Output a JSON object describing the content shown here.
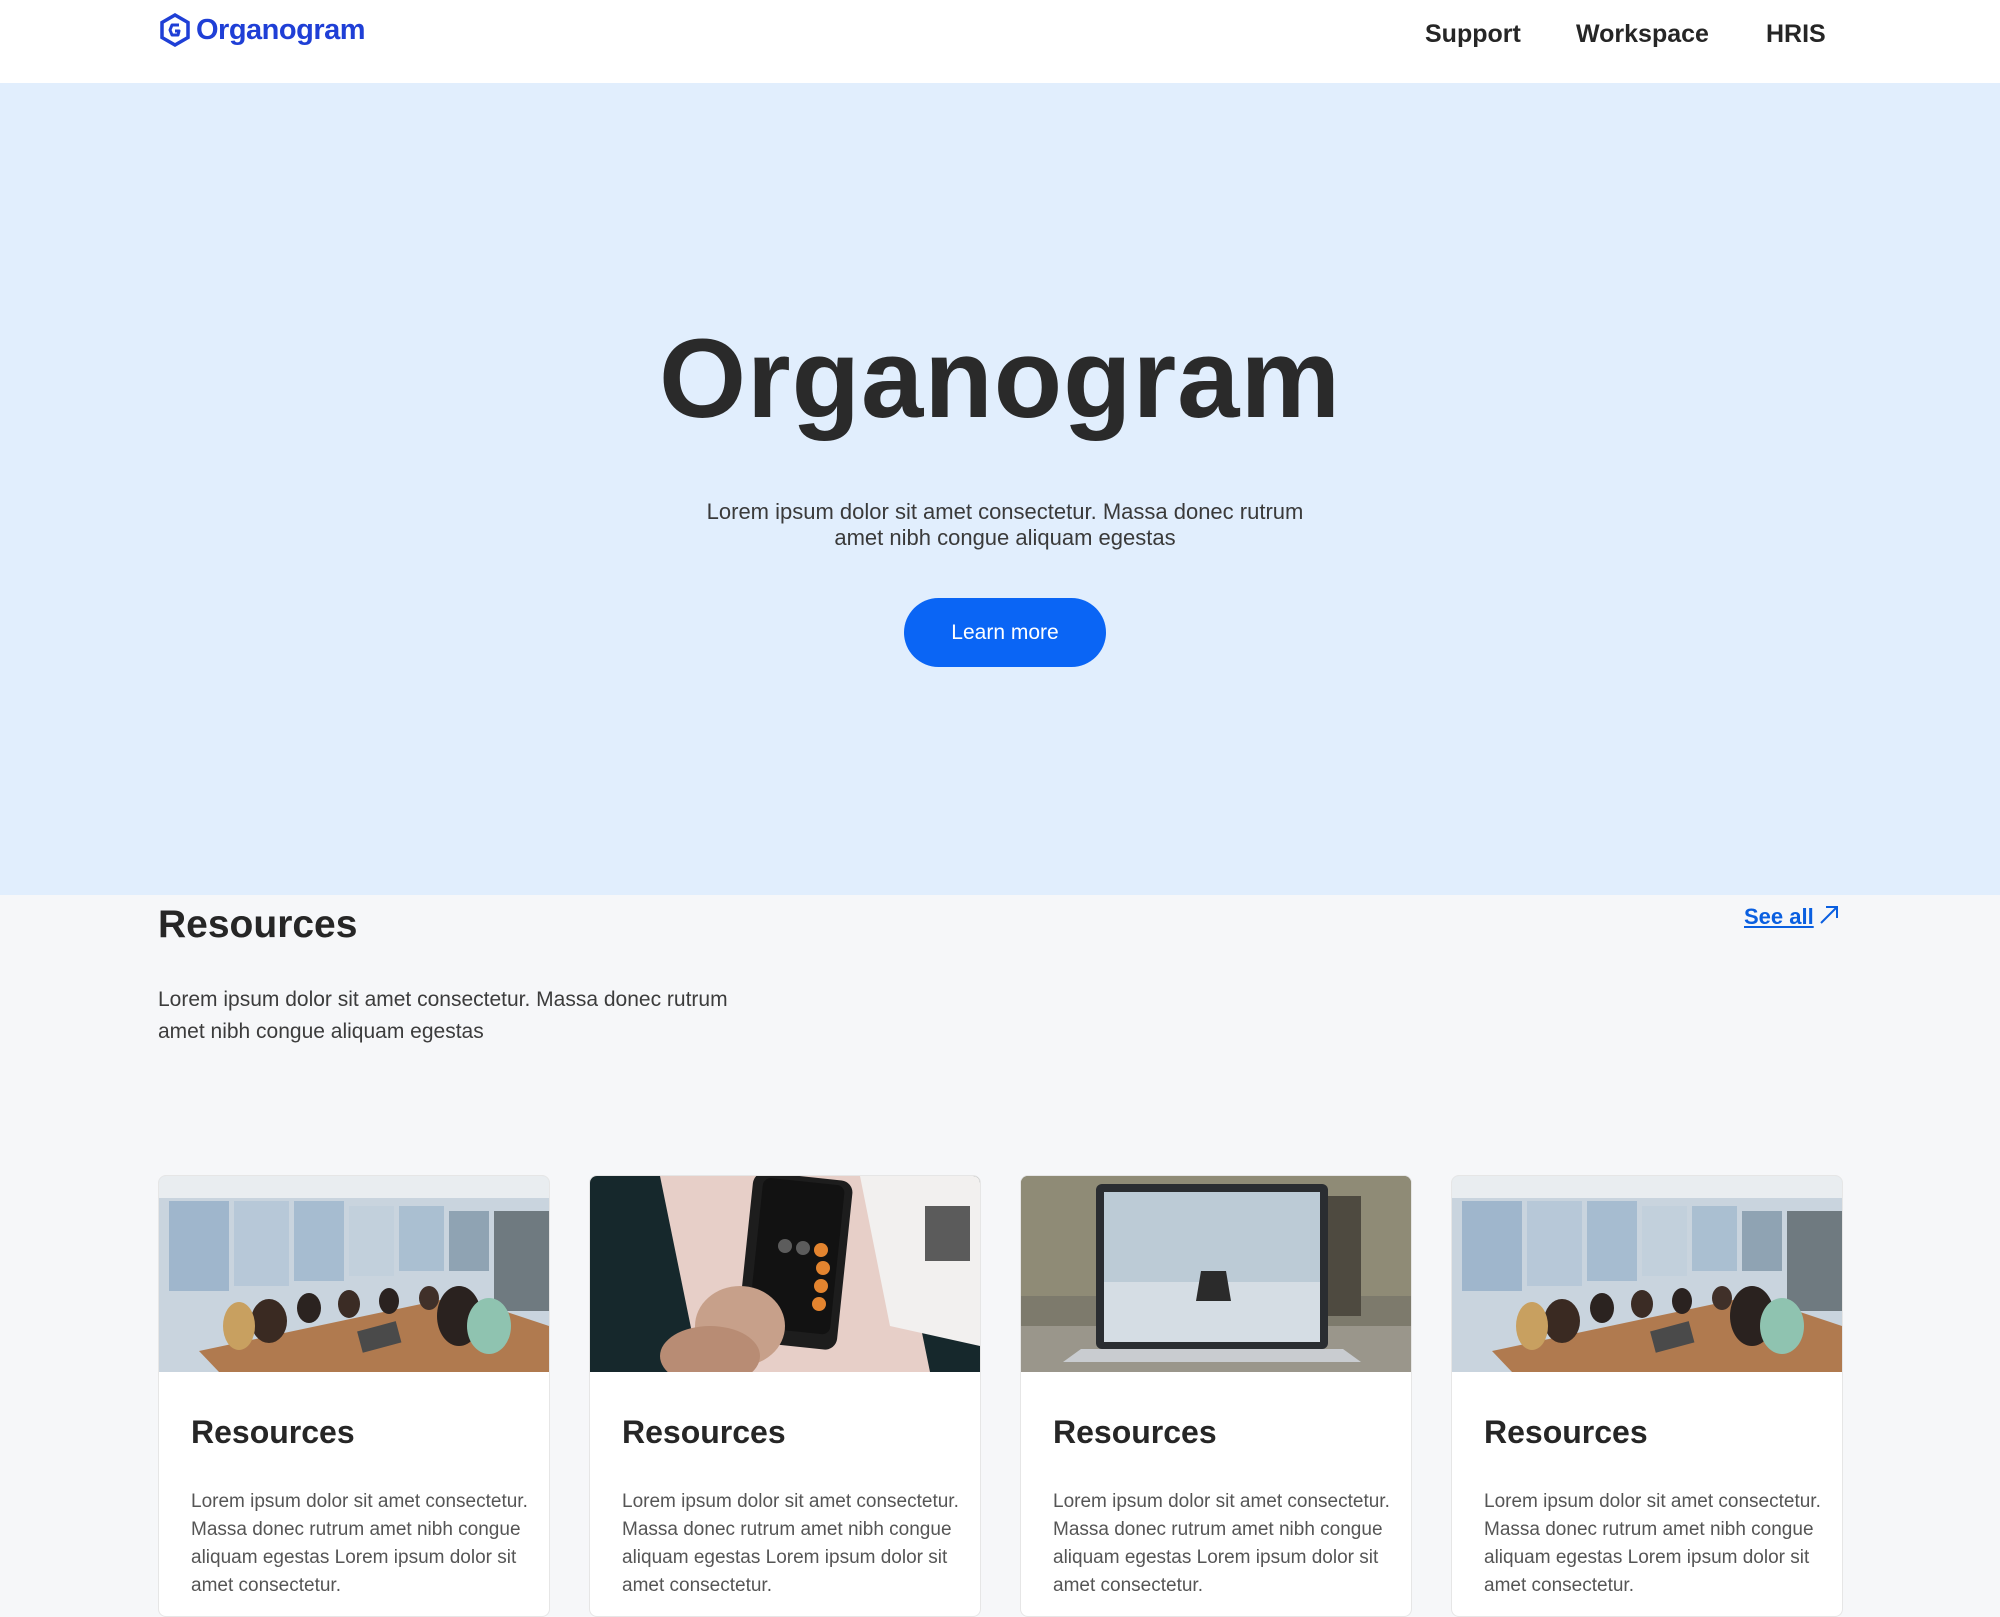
{
  "header": {
    "logo_text": "Organogram",
    "nav": [
      "Support",
      "Workspace",
      "HRIS"
    ]
  },
  "hero": {
    "title": "Organogram",
    "subtitle": "Lorem ipsum dolor sit amet consectetur. Massa donec rutrum amet nibh congue aliquam egestas",
    "cta_label": "Learn more"
  },
  "resources": {
    "heading": "Resources",
    "see_all_label": "See all",
    "description": "Lorem ipsum dolor sit amet consectetur. Massa donec rutrum amet nibh congue aliquam egestas",
    "cards": [
      {
        "title": "Resources",
        "text": "Lorem ipsum dolor sit amet consectetur. Massa donec rutrum amet nibh congue aliquam egestas Lorem ipsum dolor sit amet consectetur.",
        "image": "meeting-room-photo"
      },
      {
        "title": "Resources",
        "text": "Lorem ipsum dolor sit amet consectetur. Massa donec rutrum amet nibh congue aliquam egestas Lorem ipsum dolor sit amet consectetur.",
        "image": "calculator-phone-photo"
      },
      {
        "title": "Resources",
        "text": "Lorem ipsum dolor sit amet consectetur. Massa donec rutrum amet nibh congue aliquam egestas Lorem ipsum dolor sit amet consectetur.",
        "image": "laptop-photo"
      },
      {
        "title": "Resources",
        "text": "Lorem ipsum dolor sit amet consectetur. Massa donec rutrum amet nibh congue aliquam egestas Lorem ipsum dolor sit amet consectetur.",
        "image": "meeting-room-photo"
      }
    ]
  },
  "colors": {
    "brand": "#1f3fd6",
    "accent": "#0a65f5",
    "hero_bg": "#e1eefd",
    "link": "#0a5fe0"
  },
  "icons": {
    "logo": "hexagon-logo-icon",
    "see_all": "arrow-up-right-icon"
  }
}
